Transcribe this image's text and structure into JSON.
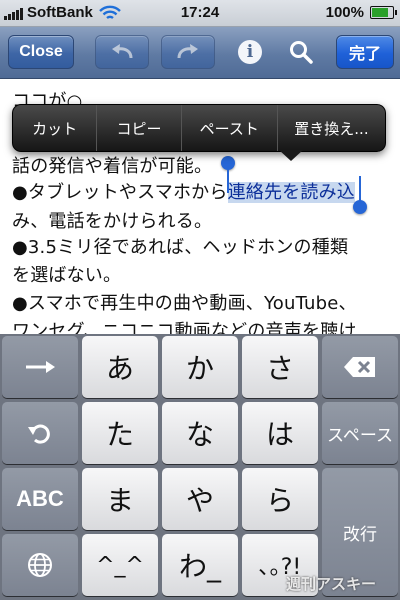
{
  "status_bar": {
    "carrier": "SoftBank",
    "time": "17:24",
    "battery": "100%",
    "battery_level": 1.0
  },
  "toolbar": {
    "close_label": "Close",
    "info_symbol": "i",
    "done_label": "完了"
  },
  "document": {
    "lines": [
      "ココが○",
      "●",
      "話の発信や着信が可能。",
      "●タブレットやスマホから",
      "連絡先を読み込",
      "み、電話をかけられる。",
      "●3.5ミリ径であれば、ヘッドホンの種類",
      "を選ばない。",
      "●スマホで再生中の曲や動画、YouTube、",
      "ワンセグ、ニコニコ動画などの音声を聴け"
    ]
  },
  "edit_menu": [
    "カット",
    "コピー",
    "ペースト",
    "置き換え..."
  ],
  "keyboard": {
    "kana_keys": [
      "あ",
      "か",
      "さ",
      "た",
      "な",
      "は",
      "ま",
      "や",
      "ら",
      "^_^",
      "わ_",
      "､｡?!"
    ],
    "space_label": "スペース",
    "return_label": "改行",
    "abc_label": "ABC",
    "arrow_symbol": "→"
  },
  "watermark": "週刊アスキー",
  "colors": {
    "toolbar": "#5f7aa3",
    "done_button": "#1f61d8",
    "selection": "#c7d8ef",
    "caret": "#2666d6"
  }
}
